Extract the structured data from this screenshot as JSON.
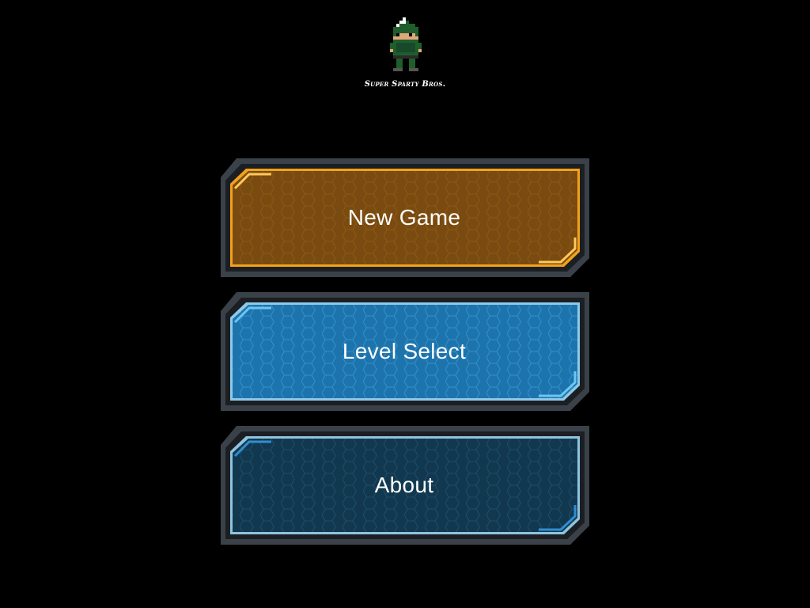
{
  "logo": {
    "title": "Super Sparty Bros.",
    "icon": "pixel-sparty-character"
  },
  "menu": {
    "buttons": [
      {
        "label": "New Game",
        "style": "gold",
        "fill": "#7a4b10",
        "rim": "#f5a418"
      },
      {
        "label": "Level Select",
        "style": "light-blue",
        "fill": "#1d74ad",
        "rim": "#4fb6ea"
      },
      {
        "label": "About",
        "style": "dark-blue",
        "fill": "#12384f",
        "rim": "#2f8ed0"
      }
    ]
  },
  "colors": {
    "background": "#000000",
    "frame": "#3a4148",
    "text": "#ffffff"
  }
}
